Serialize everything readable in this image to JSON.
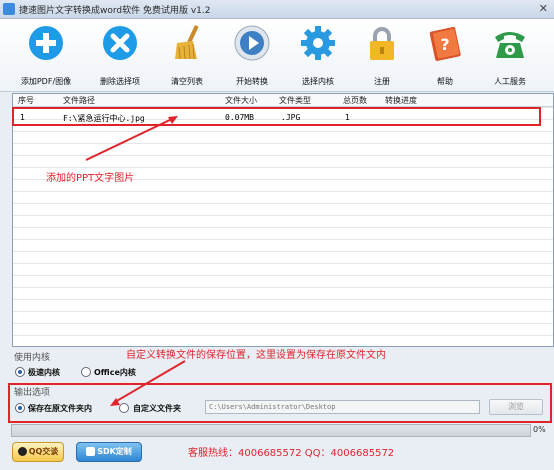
{
  "window": {
    "title": "捷速图片文字转换成word软件 免费试用版 v1.2",
    "close": "✕"
  },
  "toolbar": [
    {
      "label": "添加PDF/图像",
      "icon": "add-icon",
      "color": "#1e9be6"
    },
    {
      "label": "删除选择项",
      "icon": "delete-icon",
      "color": "#1e9be6"
    },
    {
      "label": "清空列表",
      "icon": "broom-icon",
      "color": "#e8b23a"
    },
    {
      "label": "开始转换",
      "icon": "play-icon",
      "color": "#3f7fc4"
    },
    {
      "label": "选择内核",
      "icon": "gear-icon",
      "color": "#2a9ae0"
    },
    {
      "label": "注册",
      "icon": "lock-icon",
      "color": "#f1b724"
    },
    {
      "label": "帮助",
      "icon": "help-book-icon",
      "color": "#d9532a"
    },
    {
      "label": "人工服务",
      "icon": "phone-icon",
      "color": "#2f9a4a"
    }
  ],
  "table": {
    "headers": [
      "序号",
      "文件路径",
      "文件大小",
      "文件类型",
      "总页数",
      "转换进度"
    ],
    "rows": [
      [
        "1",
        "F:\\紧急运行中心.jpg",
        "0.07MB",
        ".JPG",
        "1",
        ""
      ]
    ]
  },
  "annotations": {
    "file_note": "添加的PPT文字图片",
    "output_note": "自定义转换文件的保存位置，这里设置为保存在原文件文内"
  },
  "engine": {
    "section_label": "使用内核",
    "options": [
      {
        "label": "极速内核",
        "selected": true
      },
      {
        "label": "Office内核",
        "selected": false
      }
    ]
  },
  "output": {
    "section_label": "输出选项",
    "options": [
      {
        "label": "保存在原文件夹内",
        "selected": true
      },
      {
        "label": "自定义文件夹",
        "selected": false
      }
    ],
    "path_value": "C:\\Users\\Administrator\\Desktop",
    "browse_label": "浏览"
  },
  "progress": {
    "value": 0,
    "percent_text": "0%"
  },
  "footer": {
    "qq_label": "QQ交谈",
    "sdk_label": "SDK定制",
    "hotline": "客服热线：4006685572 QQ：4006685572"
  },
  "colors": {
    "accent_red": "#e0242c",
    "selection": "#2a5db0"
  }
}
